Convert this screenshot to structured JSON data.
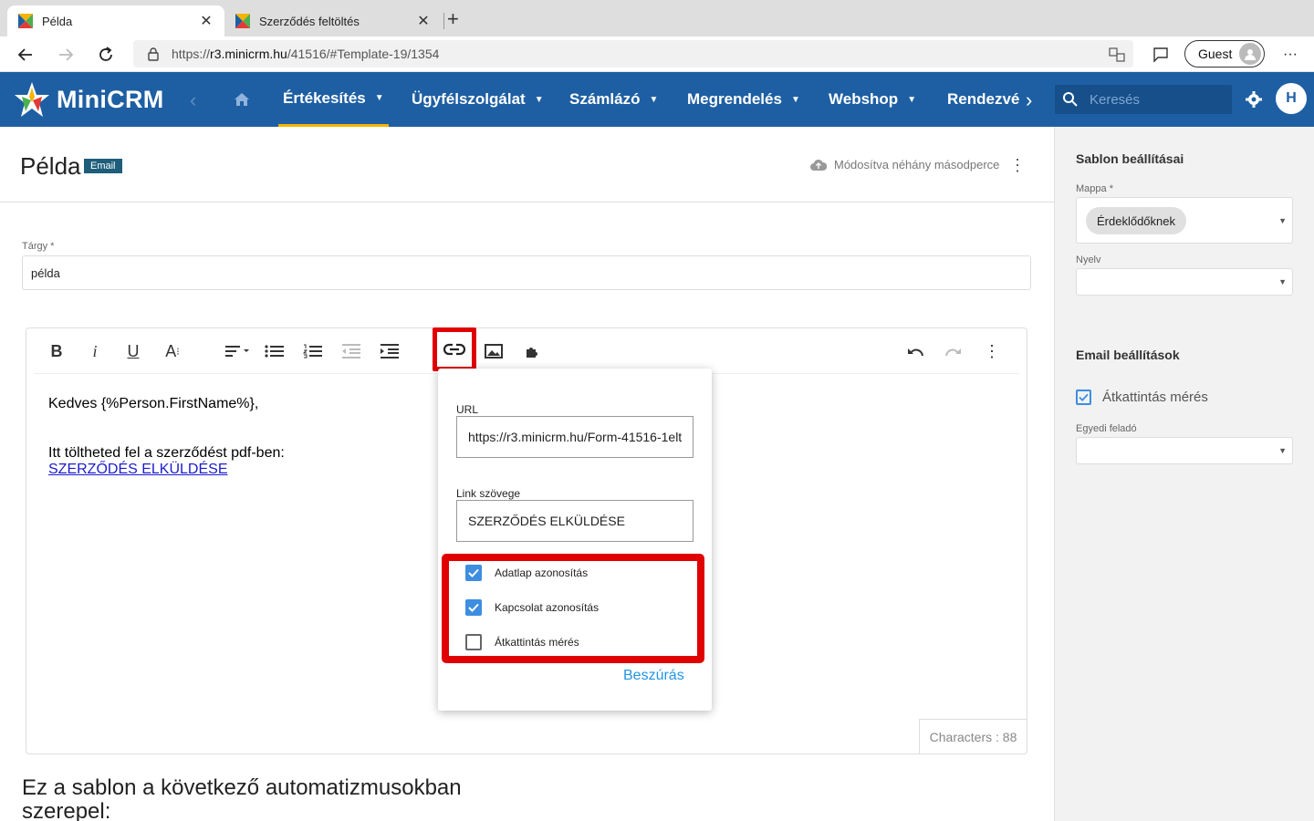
{
  "browser": {
    "tabs": [
      {
        "label": "Példa",
        "active": true
      },
      {
        "label": "Szerződés feltöltés",
        "active": false
      }
    ],
    "url_prefix": "https://",
    "url_host": "r3.minicrm.hu",
    "url_path": "/41516/#Template-19/1354",
    "guest_label": "Guest"
  },
  "app": {
    "logo_text": "MiniCRM",
    "nav": [
      {
        "label": "Értékesítés",
        "active": true
      },
      {
        "label": "Ügyfélszolgálat",
        "active": false
      },
      {
        "label": "Számlázó",
        "active": false
      },
      {
        "label": "Megrendelés",
        "active": false
      },
      {
        "label": "Webshop",
        "active": false
      },
      {
        "label": "Rendezvé",
        "active": false
      }
    ],
    "search_placeholder": "Keresés",
    "user_initial": "H",
    "accent_color": "#1e5fa3"
  },
  "page": {
    "title": "Példa",
    "badge": "Email",
    "saved_status": "Módosítva néhány másodperce",
    "subject_label": "Tárgy *",
    "subject_value": "példa",
    "automation_heading": "Ez a sablon a következő automatizmusokban szerepel:"
  },
  "editor": {
    "line1": "Kedves {%Person.FirstName%},",
    "line2": "Itt töltheted fel a szerződést pdf-ben:",
    "link_text": "SZERZŐDÉS ELKÜLDÉSE",
    "char_count": "Characters : 88"
  },
  "link_popup": {
    "url_label": "URL",
    "url_value": "https://r3.minicrm.hu/Form-41516-1elt",
    "text_label": "Link szövege",
    "text_value": "SZERZŐDÉS ELKÜLDÉSE",
    "options": [
      {
        "label": "Adatlap azonosítás",
        "checked": true
      },
      {
        "label": "Kapcsolat azonosítás",
        "checked": true
      },
      {
        "label": "Átkattintás mérés",
        "checked": false
      }
    ],
    "insert_label": "Beszúrás"
  },
  "sidebar": {
    "template_settings_title": "Sablon beállításai",
    "folder_label": "Mappa *",
    "folder_value": "Érdeklődőknek",
    "language_label": "Nyelv",
    "email_settings_title": "Email beállítások",
    "click_tracking_label": "Átkattintás mérés",
    "click_tracking_checked": true,
    "custom_sender_label": "Egyedi feladó"
  }
}
